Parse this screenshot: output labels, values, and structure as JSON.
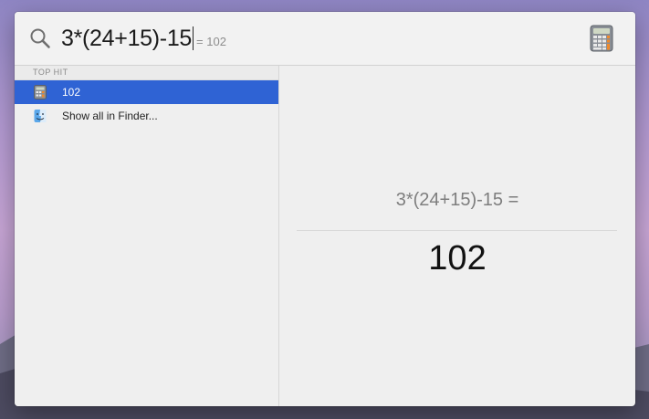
{
  "search": {
    "query": "3*(24+15)-15",
    "inline_result": "= 102",
    "icon": "search-icon",
    "app_icon": "calculator-icon"
  },
  "results": {
    "section_header": "TOP HIT",
    "items": [
      {
        "label": "102",
        "icon": "calculator-icon",
        "selected": true
      },
      {
        "label": "Show all in Finder...",
        "icon": "finder-icon",
        "selected": false
      }
    ]
  },
  "preview": {
    "expression": "3*(24+15)-15 =",
    "result": "102"
  },
  "colors": {
    "selection": "#2f63d4",
    "panel_background": "#efefef"
  }
}
